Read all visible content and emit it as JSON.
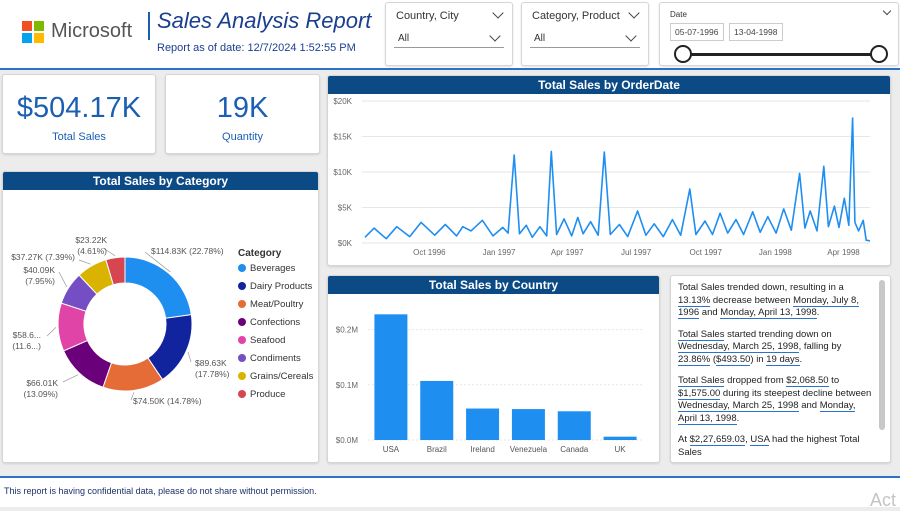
{
  "header": {
    "logo_text": "Microsoft",
    "report_title": "Sales Analysis Report",
    "report_date": "Report as of date: 12/7/2024 1:52:55 PM"
  },
  "slicers": {
    "country_city": {
      "label": "Country, City",
      "value": "All"
    },
    "category_product": {
      "label": "Category, Product",
      "value": "All"
    },
    "date": {
      "label": "Date",
      "start": "05-07-1996",
      "end": "13-04-1998",
      "range_fraction": [
        0,
        1
      ]
    }
  },
  "kpis": {
    "total_sales": {
      "value": "$504.17K",
      "label": "Total Sales"
    },
    "quantity": {
      "value": "19K",
      "label": "Quantity"
    }
  },
  "category_chart": {
    "title": "Total Sales by Category",
    "legend_title": "Category"
  },
  "orderdate_chart": {
    "title": "Total Sales by OrderDate"
  },
  "country_chart": {
    "title": "Total Sales by Country"
  },
  "narrative": {
    "p1": {
      "a": "Total Sales trended down, resulting in a ",
      "b": "13.13%",
      "c": " decrease between ",
      "d": "Monday, July 8, 1996",
      "e": " and ",
      "f": "Monday, April 13, 1998",
      "g": "."
    },
    "p2": {
      "a": "Total Sales",
      "b": " started trending down on ",
      "c": "Wednesday, March 25, 1998",
      "d": ", falling by ",
      "e": "23.86%",
      "f": " (",
      "g": "$493.50",
      "h": ") in ",
      "i": "19 days",
      "j": "."
    },
    "p3": {
      "a": "Total Sales",
      "b": " dropped from ",
      "c": "$2,068.50",
      "d": " to ",
      "e": "$1,575.00",
      "f": " during its steepest decline between ",
      "g": "Wednesday, March 25, 1998",
      "h": " and ",
      "i": "Monday, April 13, 1998",
      "j": "."
    },
    "p4": {
      "a": "At ",
      "b": "$2,27,659.03",
      "c": ", ",
      "d": "USA",
      "e": " had the highest Total Sales"
    }
  },
  "footer": {
    "text": "This report is having confidential data, please do not share without permission."
  },
  "watermark": {
    "text": "Act"
  },
  "colors": {
    "accent": "#0c4a86",
    "kpi": "#1b5fb3",
    "bar": "#1f8ef1"
  },
  "chart_data": [
    {
      "type": "pie",
      "title": "Total Sales by Category",
      "legend_title": "Category",
      "categories": [
        "Beverages",
        "Dairy Products",
        "Meat/Poultry",
        "Confections",
        "Seafood",
        "Condiments",
        "Grains/Cereals",
        "Produce"
      ],
      "values": [
        114.83,
        89.63,
        74.5,
        66.01,
        58.6,
        40.09,
        37.27,
        23.22
      ],
      "data_labels": [
        "$114.83K (22.78%)",
        "$89.63K (17.78%)",
        "$74.50K (14.78%)",
        "$66.01K (13.09%)",
        "$58.6... (11.6...)",
        "$40.09K (7.95%)",
        "$37.27K (7.39%)",
        "$23.22K (4.61%)"
      ],
      "colors": [
        "#1f8ef1",
        "#12239e",
        "#e66c37",
        "#6b007b",
        "#e044a7",
        "#744ec2",
        "#d9b300",
        "#d64550"
      ],
      "legend_position": "right"
    },
    {
      "type": "line",
      "title": "Total Sales by OrderDate",
      "x_ticks": [
        "Oct 1996",
        "Jan 1997",
        "Apr 1997",
        "Jul 1997",
        "Oct 1997",
        "Jan 1998",
        "Apr 1998"
      ],
      "y_ticks": [
        "$0K",
        "$5K",
        "$10K",
        "$15K",
        "$20K"
      ],
      "ylim": [
        0,
        20000
      ],
      "x_range": [
        "1996-07-04",
        "1998-05-06"
      ],
      "series": [
        {
          "values": [
            {
              "x": "1996-07-08",
              "y": 800
            },
            {
              "x": "1996-07-20",
              "y": 2100
            },
            {
              "x": "1996-08-05",
              "y": 600
            },
            {
              "x": "1996-08-19",
              "y": 2300
            },
            {
              "x": "1996-09-05",
              "y": 900
            },
            {
              "x": "1996-09-20",
              "y": 2900
            },
            {
              "x": "1996-10-08",
              "y": 1100
            },
            {
              "x": "1996-10-22",
              "y": 2600
            },
            {
              "x": "1996-11-06",
              "y": 1000
            },
            {
              "x": "1996-11-14",
              "y": 2300
            },
            {
              "x": "1996-11-25",
              "y": 1700
            },
            {
              "x": "1996-12-10",
              "y": 3200
            },
            {
              "x": "1996-12-24",
              "y": 1000
            },
            {
              "x": "1997-01-06",
              "y": 2200
            },
            {
              "x": "1997-01-13",
              "y": 1400
            },
            {
              "x": "1997-01-21",
              "y": 12400
            },
            {
              "x": "1997-01-28",
              "y": 1300
            },
            {
              "x": "1997-02-06",
              "y": 2500
            },
            {
              "x": "1997-02-14",
              "y": 800
            },
            {
              "x": "1997-02-24",
              "y": 2300
            },
            {
              "x": "1997-03-05",
              "y": 1000
            },
            {
              "x": "1997-03-11",
              "y": 12900
            },
            {
              "x": "1997-03-18",
              "y": 1200
            },
            {
              "x": "1997-03-28",
              "y": 3400
            },
            {
              "x": "1997-04-07",
              "y": 1000
            },
            {
              "x": "1997-04-15",
              "y": 3600
            },
            {
              "x": "1997-04-22",
              "y": 1300
            },
            {
              "x": "1997-05-02",
              "y": 3000
            },
            {
              "x": "1997-05-12",
              "y": 1100
            },
            {
              "x": "1997-05-20",
              "y": 12800
            },
            {
              "x": "1997-05-28",
              "y": 1200
            },
            {
              "x": "1997-06-09",
              "y": 2600
            },
            {
              "x": "1997-06-20",
              "y": 900
            },
            {
              "x": "1997-07-03",
              "y": 4500
            },
            {
              "x": "1997-07-14",
              "y": 1100
            },
            {
              "x": "1997-07-25",
              "y": 2700
            },
            {
              "x": "1997-08-06",
              "y": 900
            },
            {
              "x": "1997-08-18",
              "y": 3300
            },
            {
              "x": "1997-08-29",
              "y": 1100
            },
            {
              "x": "1997-09-10",
              "y": 7600
            },
            {
              "x": "1997-09-18",
              "y": 1200
            },
            {
              "x": "1997-09-30",
              "y": 3100
            },
            {
              "x": "1997-10-10",
              "y": 1200
            },
            {
              "x": "1997-10-20",
              "y": 4200
            },
            {
              "x": "1997-10-30",
              "y": 1400
            },
            {
              "x": "1997-11-10",
              "y": 3300
            },
            {
              "x": "1997-11-20",
              "y": 1200
            },
            {
              "x": "1997-12-02",
              "y": 4400
            },
            {
              "x": "1997-12-12",
              "y": 1500
            },
            {
              "x": "1997-12-22",
              "y": 3700
            },
            {
              "x": "1998-01-02",
              "y": 1400
            },
            {
              "x": "1998-01-12",
              "y": 4800
            },
            {
              "x": "1998-01-22",
              "y": 1800
            },
            {
              "x": "1998-02-02",
              "y": 9800
            },
            {
              "x": "1998-02-09",
              "y": 2100
            },
            {
              "x": "1998-02-16",
              "y": 4500
            },
            {
              "x": "1998-02-25",
              "y": 1700
            },
            {
              "x": "1998-03-06",
              "y": 10800
            },
            {
              "x": "1998-03-12",
              "y": 2300
            },
            {
              "x": "1998-03-20",
              "y": 5200
            },
            {
              "x": "1998-03-26",
              "y": 2200
            },
            {
              "x": "1998-04-02",
              "y": 6300
            },
            {
              "x": "1998-04-08",
              "y": 2500
            },
            {
              "x": "1998-04-13",
              "y": 17600
            },
            {
              "x": "1998-04-16",
              "y": 2900
            },
            {
              "x": "1998-04-21",
              "y": 1700
            },
            {
              "x": "1998-04-27",
              "y": 3200
            },
            {
              "x": "1998-05-01",
              "y": 400
            },
            {
              "x": "1998-05-06",
              "y": 300
            }
          ]
        }
      ]
    },
    {
      "type": "bar",
      "title": "Total Sales by Country",
      "categories": [
        "USA",
        "Brazil",
        "Ireland",
        "Venezuela",
        "Canada",
        "UK"
      ],
      "values": [
        227659.03,
        107000,
        57000,
        56000,
        52000,
        6000
      ],
      "y_ticks": [
        "$0.0M",
        "$0.1M",
        "$0.2M"
      ],
      "ylim": [
        0,
        0.25
      ]
    }
  ]
}
